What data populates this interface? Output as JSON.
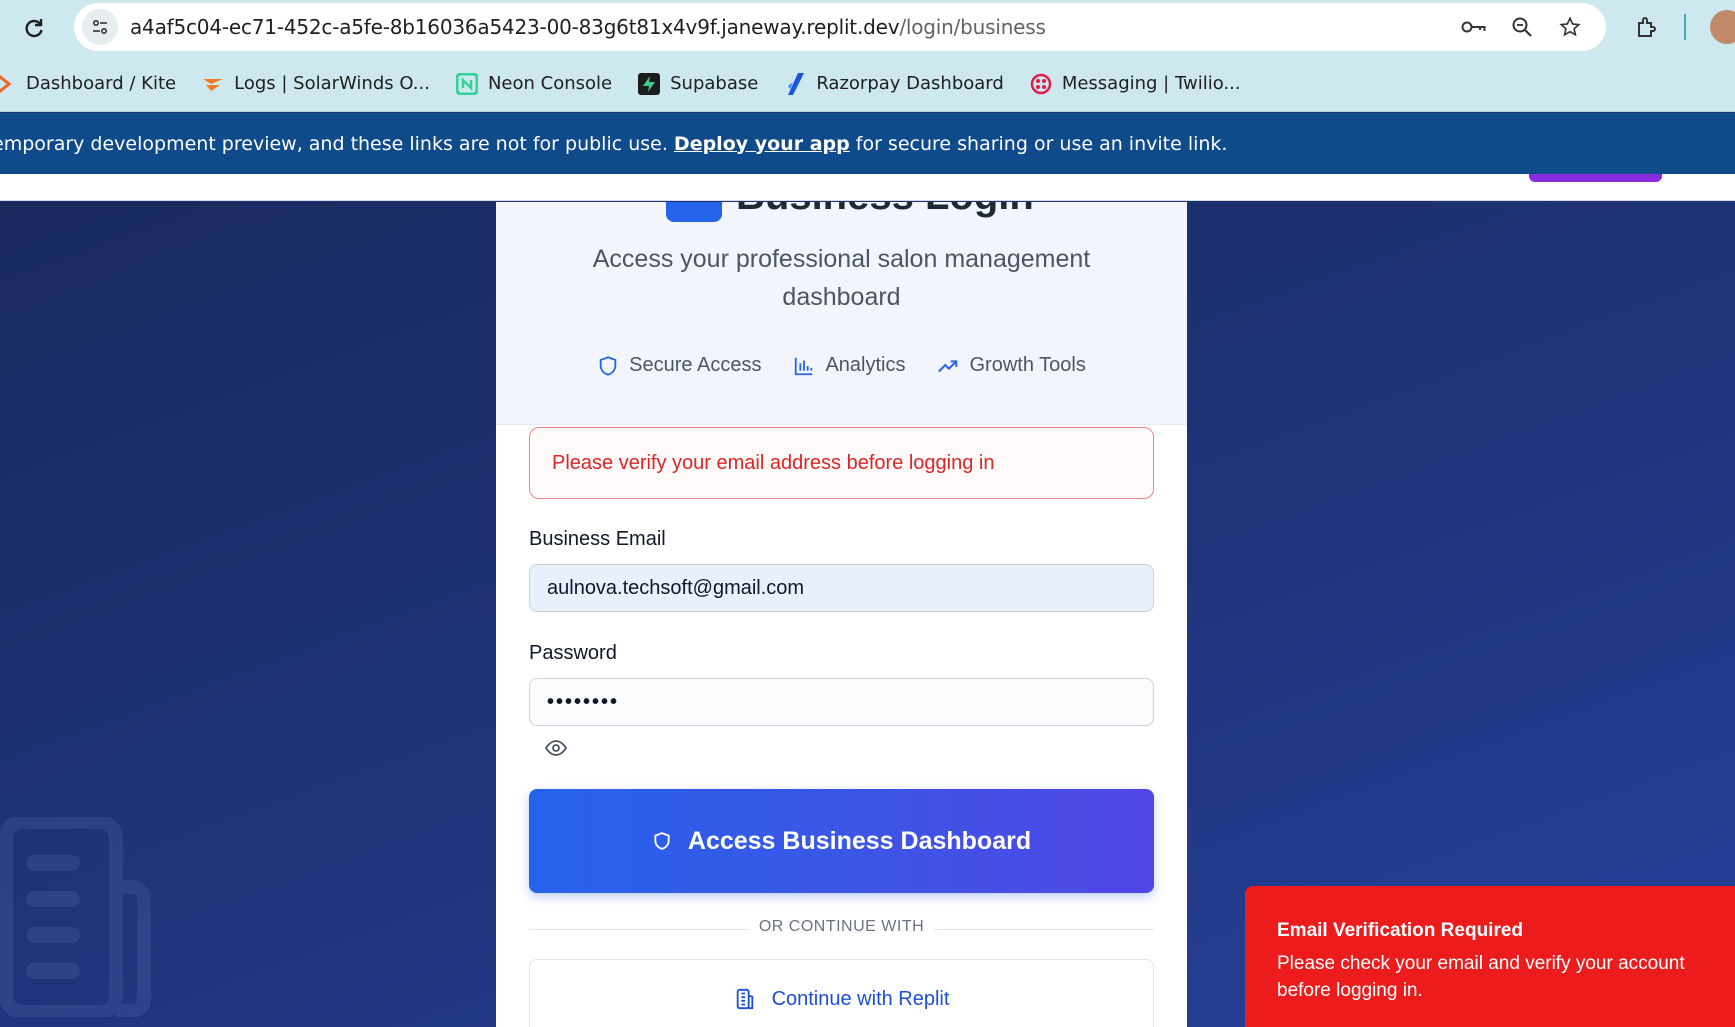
{
  "browser": {
    "url_host": "a4af5c04-ec71-452c-a5fe-8b16036a5423-00-83g6t81x4v9f.janeway.replit.dev",
    "url_path": "/login/business",
    "bookmarks": [
      {
        "label": "Dashboard / Kite",
        "icon": "kite-icon"
      },
      {
        "label": "Logs | SolarWinds O...",
        "icon": "solarwinds-icon"
      },
      {
        "label": "Neon Console",
        "icon": "neon-icon"
      },
      {
        "label": "Supabase",
        "icon": "supabase-icon"
      },
      {
        "label": "Razorpay Dashboard",
        "icon": "razorpay-icon"
      },
      {
        "label": "Messaging | Twilio...",
        "icon": "twilio-icon"
      }
    ]
  },
  "banner": {
    "text_before": "emporary development preview, and these links are not for public use. ",
    "link": "Deploy your app",
    "text_after": " for secure sharing or use an invite link."
  },
  "card": {
    "title": "Business Login",
    "subtitle": "Access your professional salon management dashboard",
    "features": [
      "Secure Access",
      "Analytics",
      "Growth Tools"
    ],
    "alert": "Please verify your email address before logging in",
    "email_label": "Business Email",
    "email_value": "aulnova.techsoft@gmail.com",
    "password_label": "Password",
    "password_value": "••••••••",
    "submit_label": "Access Business Dashboard",
    "divider_text": "OR CONTINUE WITH",
    "replit_label": "Continue with Replit"
  },
  "toast": {
    "title": "Email Verification Required",
    "body": "Please check your email and verify your account before logging in."
  },
  "colors": {
    "primary": "#2563eb",
    "error": "#dc2626",
    "toast": "#ec1c1c",
    "banner": "#0f4a8a"
  }
}
